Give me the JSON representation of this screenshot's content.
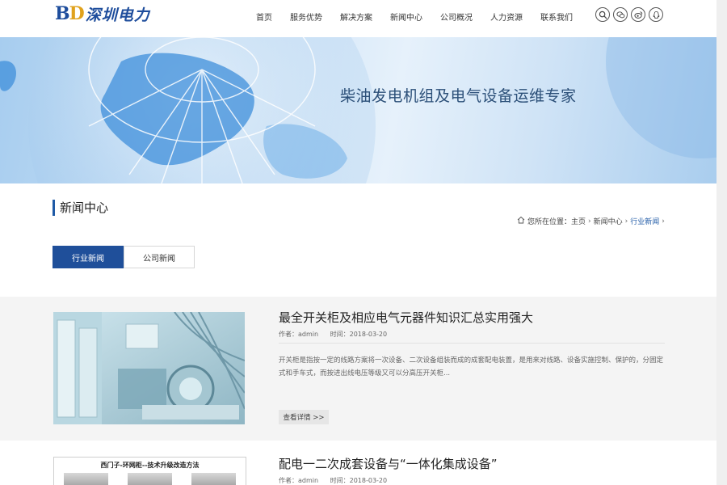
{
  "logo": {
    "latin_b": "B",
    "latin_d": "D",
    "cn": "深圳电力"
  },
  "nav": [
    {
      "label": "首页"
    },
    {
      "label": "服务优势"
    },
    {
      "label": "解决方案"
    },
    {
      "label": "新闻中心"
    },
    {
      "label": "公司概况"
    },
    {
      "label": "人力资源"
    },
    {
      "label": "联系我们"
    }
  ],
  "social_icons": [
    "search-icon",
    "wechat-icon",
    "weibo-icon",
    "qq-icon"
  ],
  "banner": {
    "slogan": "柴油发电机组及电气设备运维专家"
  },
  "section": {
    "title": "新闻中心"
  },
  "breadcrumb": {
    "prefix": "您所在位置：",
    "home": "主页",
    "level1": "新闻中心",
    "current": "行业新闻",
    "sep": "›"
  },
  "tabs": [
    {
      "label": "行业新闻",
      "active": true
    },
    {
      "label": "公司新闻",
      "active": false
    }
  ],
  "articles": [
    {
      "title": "最全开关柜及相应电气元器件知识汇总实用强大",
      "author": "作者：admin",
      "date": "时间：2018-03-20",
      "desc": "开关柜是指按一定的线路方案将一次设备、二次设备组装而成的成套配电装置，是用来对线路、设备实施控制、保护的，分固定式和手车式，而按进出线电压等级又可以分高压开关柜...",
      "more": "查看详情 >>"
    },
    {
      "title": "配电一二次成套设备与“一体化集成设备”",
      "author": "作者：admin",
      "date": "时间：2018-03-20",
      "image_caption": "西门子-环网柜--技术升级改造方法"
    }
  ],
  "colors": {
    "primary": "#1f4f9a",
    "accent": "#e0a21d"
  }
}
